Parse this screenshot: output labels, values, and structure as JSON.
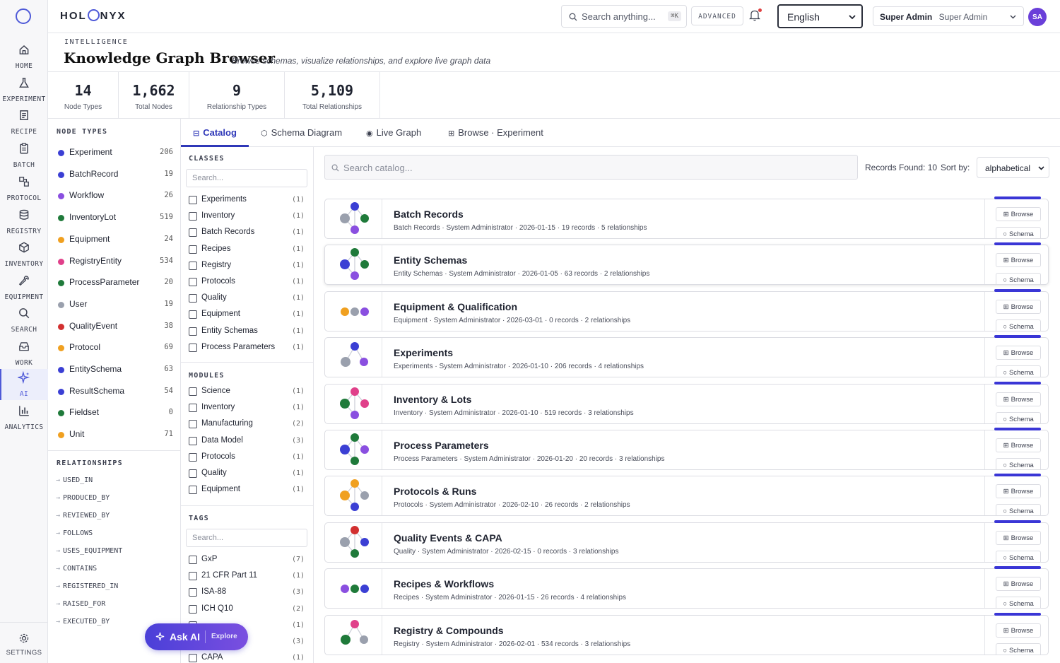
{
  "brand": {
    "left": "HOL",
    "right": "NYX"
  },
  "nav": [
    {
      "label": "HOME",
      "icon": "home-icon"
    },
    {
      "label": "EXPERIMENT",
      "icon": "flask-icon"
    },
    {
      "label": "RECIPE",
      "icon": "recipe-icon"
    },
    {
      "label": "BATCH",
      "icon": "clipboard-icon"
    },
    {
      "label": "PROTOCOL",
      "icon": "protocol-icon"
    },
    {
      "label": "REGISTRY",
      "icon": "database-icon"
    },
    {
      "label": "INVENTORY",
      "icon": "box-icon"
    },
    {
      "label": "EQUIPMENT",
      "icon": "wrench-icon"
    },
    {
      "label": "SEARCH",
      "icon": "search-icon"
    },
    {
      "label": "WORK",
      "icon": "inbox-icon"
    },
    {
      "label": "AI",
      "icon": "sparkle-icon",
      "active": true
    },
    {
      "label": "ANALYTICS",
      "icon": "bar-chart-icon"
    }
  ],
  "settings": {
    "label": "SETTINGS"
  },
  "topbar": {
    "search_placeholder": "Search anything...",
    "shortcut": "⌘K",
    "advanced": "ADVANCED",
    "language": "English",
    "user_name": "Super Admin",
    "user_role": "Super Admin",
    "avatar": "SA"
  },
  "header": {
    "eyebrow": "INTELLIGENCE",
    "title": "Knowledge Graph Browser",
    "subtitle": "Browse schemas, visualize relationships, and explore live graph data"
  },
  "stats": [
    {
      "value": "14",
      "label": "Node Types"
    },
    {
      "value": "1,662",
      "label": "Total Nodes"
    },
    {
      "value": "9",
      "label": "Relationship Types"
    },
    {
      "value": "5,109",
      "label": "Total Relationships"
    }
  ],
  "node_types_heading": "NODE TYPES",
  "node_types": [
    {
      "name": "Experiment",
      "count": "206",
      "color": "#3b3fd4"
    },
    {
      "name": "BatchRecord",
      "count": "19",
      "color": "#3b3fd4"
    },
    {
      "name": "Workflow",
      "count": "26",
      "color": "#8a4fe0"
    },
    {
      "name": "InventoryLot",
      "count": "519",
      "color": "#1f7a3a"
    },
    {
      "name": "Equipment",
      "count": "24",
      "color": "#f0a020"
    },
    {
      "name": "RegistryEntity",
      "count": "534",
      "color": "#e0408a"
    },
    {
      "name": "ProcessParameter",
      "count": "20",
      "color": "#1f7a3a"
    },
    {
      "name": "User",
      "count": "19",
      "color": "#9aa0ad"
    },
    {
      "name": "QualityEvent",
      "count": "38",
      "color": "#d23030"
    },
    {
      "name": "Protocol",
      "count": "69",
      "color": "#f0a020"
    },
    {
      "name": "EntitySchema",
      "count": "63",
      "color": "#3b3fd4"
    },
    {
      "name": "ResultSchema",
      "count": "54",
      "color": "#3b3fd4"
    },
    {
      "name": "Fieldset",
      "count": "0",
      "color": "#1f7a3a"
    },
    {
      "name": "Unit",
      "count": "71",
      "color": "#f0a020"
    }
  ],
  "relationships_heading": "RELATIONSHIPS",
  "relationships": [
    "USED_IN",
    "PRODUCED_BY",
    "REVIEWED_BY",
    "FOLLOWS",
    "USES_EQUIPMENT",
    "CONTAINS",
    "REGISTERED_IN",
    "RAISED_FOR",
    "EXECUTED_BY"
  ],
  "tabs": [
    {
      "label": "Catalog",
      "icon": "list-icon",
      "active": true
    },
    {
      "label": "Schema Diagram",
      "icon": "hexagon-icon"
    },
    {
      "label": "Live Graph",
      "icon": "radio-icon"
    },
    {
      "label": "Browse · Experiment",
      "icon": "grid-icon"
    }
  ],
  "filters": {
    "classes_heading": "CLASSES",
    "classes_placeholder": "Search...",
    "classes": [
      {
        "name": "Experiments",
        "count": "(1)"
      },
      {
        "name": "Inventory",
        "count": "(1)"
      },
      {
        "name": "Batch Records",
        "count": "(1)"
      },
      {
        "name": "Recipes",
        "count": "(1)"
      },
      {
        "name": "Registry",
        "count": "(1)"
      },
      {
        "name": "Protocols",
        "count": "(1)"
      },
      {
        "name": "Quality",
        "count": "(1)"
      },
      {
        "name": "Equipment",
        "count": "(1)"
      },
      {
        "name": "Entity Schemas",
        "count": "(1)"
      },
      {
        "name": "Process Parameters",
        "count": "(1)"
      }
    ],
    "modules_heading": "MODULES",
    "modules": [
      {
        "name": "Science",
        "count": "(1)"
      },
      {
        "name": "Inventory",
        "count": "(1)"
      },
      {
        "name": "Manufacturing",
        "count": "(2)"
      },
      {
        "name": "Data Model",
        "count": "(3)"
      },
      {
        "name": "Protocols",
        "count": "(1)"
      },
      {
        "name": "Quality",
        "count": "(1)"
      },
      {
        "name": "Equipment",
        "count": "(1)"
      }
    ],
    "tags_heading": "TAGS",
    "tags_placeholder": "Search...",
    "tags": [
      {
        "name": "GxP",
        "count": "(7)"
      },
      {
        "name": "21 CFR Part 11",
        "count": "(1)"
      },
      {
        "name": "ISA-88",
        "count": "(3)"
      },
      {
        "name": "ICH Q10",
        "count": "(2)"
      },
      {
        "name": "",
        "count": "(1)"
      },
      {
        "name": "",
        "count": "(3)"
      },
      {
        "name": "CAPA",
        "count": "(1)"
      }
    ]
  },
  "catalog": {
    "search_placeholder": "Search catalog...",
    "records_found": "Records Found: 10",
    "sort_label": "Sort by:",
    "sort_value": "alphabetical",
    "browse_label": "Browse",
    "schema_label": "Schema",
    "items": [
      {
        "title": "Batch Records",
        "meta": "Batch Records · System Administrator · 2026-01-15 · 19 records · 5 relationships",
        "dots": [
          "#3b3fd4",
          "#9aa0ad",
          "#1f7a3a",
          "#8a4fe0"
        ]
      },
      {
        "title": "Entity Schemas",
        "meta": "Entity Schemas · System Administrator · 2026-01-05 · 63 records · 2 relationships",
        "dots": [
          "#1f7a3a",
          "#3b3fd4",
          "#1f7a3a",
          "#8a4fe0"
        ]
      },
      {
        "title": "Equipment & Qualification",
        "meta": "Equipment · System Administrator · 2026-03-01 · 0 records · 2 relationships",
        "dots": [
          "#f0a020",
          "#9aa0ad",
          "#8a4fe0"
        ]
      },
      {
        "title": "Experiments",
        "meta": "Experiments · System Administrator · 2026-01-10 · 206 records · 4 relationships",
        "dots": [
          "#3b3fd4",
          "#9aa0ad",
          "#8a4fe0"
        ]
      },
      {
        "title": "Inventory & Lots",
        "meta": "Inventory · System Administrator · 2026-01-10 · 519 records · 3 relationships",
        "dots": [
          "#e0408a",
          "#1f7a3a",
          "#e0408a",
          "#8a4fe0"
        ]
      },
      {
        "title": "Process Parameters",
        "meta": "Process Parameters · System Administrator · 2026-01-20 · 20 records · 3 relationships",
        "dots": [
          "#1f7a3a",
          "#3b3fd4",
          "#8a4fe0",
          "#1f7a3a"
        ]
      },
      {
        "title": "Protocols & Runs",
        "meta": "Protocols · System Administrator · 2026-02-10 · 26 records · 2 relationships",
        "dots": [
          "#f0a020",
          "#f0a020",
          "#9aa0ad",
          "#3b3fd4"
        ]
      },
      {
        "title": "Quality Events & CAPA",
        "meta": "Quality · System Administrator · 2026-02-15 · 0 records · 3 relationships",
        "dots": [
          "#d23030",
          "#9aa0ad",
          "#3b3fd4",
          "#1f7a3a"
        ]
      },
      {
        "title": "Recipes & Workflows",
        "meta": "Recipes · System Administrator · 2026-01-15 · 26 records · 4 relationships",
        "dots": [
          "#8a4fe0",
          "#1f7a3a",
          "#3b3fd4"
        ]
      },
      {
        "title": "Registry & Compounds",
        "meta": "Registry · System Administrator · 2026-02-01 · 534 records · 3 relationships",
        "dots": [
          "#e0408a",
          "#1f7a3a",
          "#9aa0ad"
        ]
      }
    ]
  },
  "ask_ai": {
    "label": "Ask AI",
    "explore": "Explore"
  }
}
